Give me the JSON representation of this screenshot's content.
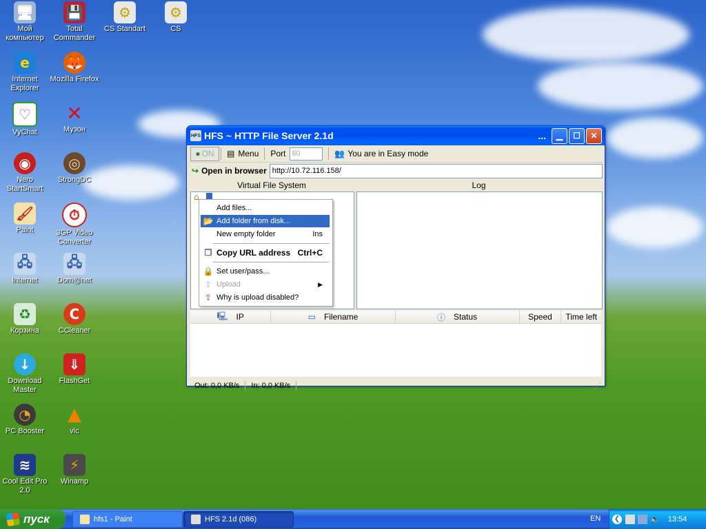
{
  "desktop": {
    "icons": [
      {
        "label_1": "Мой",
        "label_2": "компьютер",
        "name": "my-computer-icon"
      },
      {
        "label_1": "Total",
        "label_2": "Commander",
        "name": "total-commander-icon"
      },
      {
        "label_1": "CS Standart",
        "label_2": "",
        "name": "cs-standart-icon"
      },
      {
        "label_1": "CS",
        "label_2": "",
        "name": "cs-icon"
      },
      {
        "label_1": "Internet",
        "label_2": "Explorer",
        "name": "internet-explorer-icon"
      },
      {
        "label_1": "Mozilla Firefox",
        "label_2": "",
        "name": "firefox-icon"
      },
      {
        "label_1": "VyChat",
        "label_2": "",
        "name": "vychat-icon"
      },
      {
        "label_1": "Музон",
        "label_2": "",
        "name": "muzon-icon"
      },
      {
        "label_1": "Nero",
        "label_2": "StartSmart",
        "name": "nero-icon"
      },
      {
        "label_1": "StrongDC",
        "label_2": "",
        "name": "strongdc-icon"
      },
      {
        "label_1": "Paint",
        "label_2": "",
        "name": "paint-icon"
      },
      {
        "label_1": "3GP Video",
        "label_2": "Converter",
        "name": "3gp-converter-icon"
      },
      {
        "label_1": "Internet",
        "label_2": "",
        "name": "internet-icon"
      },
      {
        "label_1": "Dom@net",
        "label_2": "",
        "name": "domnet-icon"
      },
      {
        "label_1": "Корзина",
        "label_2": "",
        "name": "recycle-bin-icon"
      },
      {
        "label_1": "CCleaner",
        "label_2": "",
        "name": "ccleaner-icon"
      },
      {
        "label_1": "Download",
        "label_2": "Master",
        "name": "download-master-icon"
      },
      {
        "label_1": "FlashGet",
        "label_2": "",
        "name": "flashget-icon"
      },
      {
        "label_1": "PC Booster",
        "label_2": "",
        "name": "pc-booster-icon"
      },
      {
        "label_1": "vlc",
        "label_2": "",
        "name": "vlc-icon"
      },
      {
        "label_1": "Cool Edit Pro",
        "label_2": "2.0",
        "name": "cool-edit-icon"
      },
      {
        "label_1": "Winamp",
        "label_2": "",
        "name": "winamp-icon"
      }
    ]
  },
  "window": {
    "title": "HFS ~ HTTP File Server 2.1d",
    "title_more": "...",
    "app_icon_text": "HFS",
    "toolbar": {
      "on_label": "ON",
      "menu_label": "Menu",
      "port_label": "Port",
      "port_value": "80",
      "mode_label": "You are in Easy mode"
    },
    "urlbar": {
      "open_label": "Open in browser",
      "url": "http://10.72.116.158/"
    },
    "panes": {
      "vfs_header": "Virtual File System",
      "log_header": "Log"
    },
    "connections": {
      "columns": [
        "IP",
        "Filename",
        "Status",
        "Speed",
        "Time left"
      ]
    },
    "status": {
      "out": "Out: 0,0 KB/s",
      "in": "In: 0,0 KB/s"
    }
  },
  "context_menu": {
    "items": [
      {
        "label": "Add files...",
        "shortcut": ""
      },
      {
        "label": "Add folder from disk...",
        "shortcut": ""
      },
      {
        "label": "New empty folder",
        "shortcut": "Ins"
      },
      {
        "label": "Copy URL address",
        "shortcut": "Ctrl+C"
      },
      {
        "label": "Set user/pass...",
        "shortcut": ""
      },
      {
        "label": "Upload",
        "shortcut": ""
      },
      {
        "label": "Why is upload disabled?",
        "shortcut": ""
      }
    ]
  },
  "taskbar": {
    "start_label": "пуск",
    "tasks": [
      {
        "label": "hfs1 - Paint"
      },
      {
        "label": "HFS 2.1d (086)"
      }
    ],
    "language": "EN",
    "clock": "13:54"
  },
  "colors": {
    "selection": "#316ac5",
    "title_blue": "#0053ee",
    "start_green": "#3c9d3c"
  }
}
